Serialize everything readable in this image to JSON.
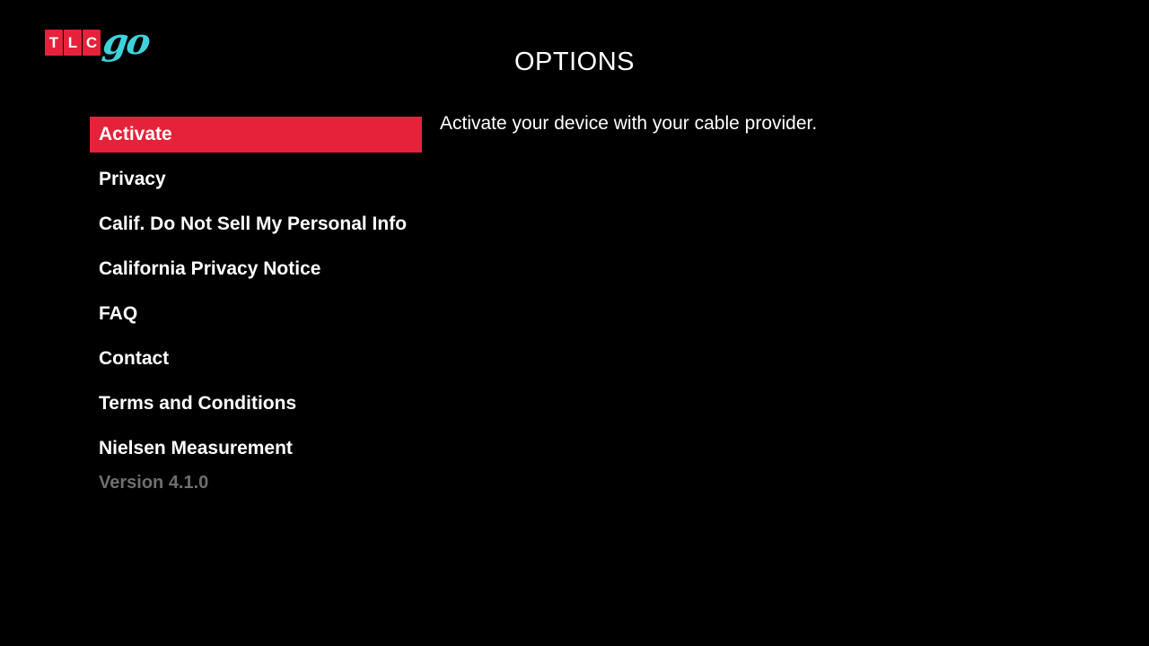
{
  "logo": {
    "letters": [
      "T",
      "L",
      "C"
    ],
    "script": "go",
    "tile_color": "#e5223a",
    "script_color": "#3fd2dc"
  },
  "header": {
    "title": "OPTIONS"
  },
  "menu": {
    "selected_color": "#e5223a",
    "items": [
      {
        "label": "Activate",
        "selected": true
      },
      {
        "label": "Privacy",
        "selected": false
      },
      {
        "label": "Calif. Do Not Sell My Personal Info",
        "selected": false
      },
      {
        "label": "California Privacy Notice",
        "selected": false
      },
      {
        "label": "FAQ",
        "selected": false
      },
      {
        "label": "Contact",
        "selected": false
      },
      {
        "label": "Terms and Conditions",
        "selected": false
      },
      {
        "label": "Nielsen Measurement",
        "selected": false
      }
    ]
  },
  "version": {
    "label": "Version 4.1.0",
    "color": "#6e6e6e"
  },
  "detail": {
    "description": "Activate your device with your cable provider."
  }
}
